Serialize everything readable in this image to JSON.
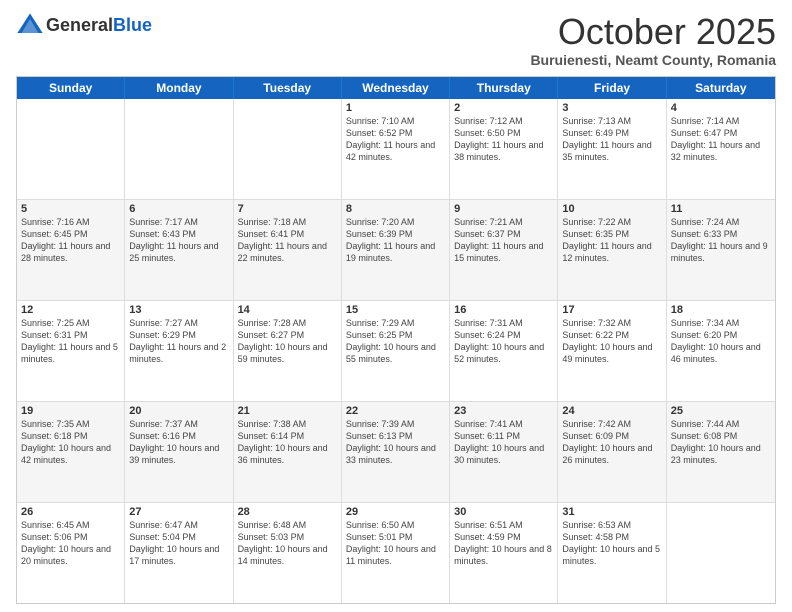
{
  "logo": {
    "general": "General",
    "blue": "Blue"
  },
  "title": "October 2025",
  "location": "Buruienesti, Neamt County, Romania",
  "days": [
    "Sunday",
    "Monday",
    "Tuesday",
    "Wednesday",
    "Thursday",
    "Friday",
    "Saturday"
  ],
  "weeks": [
    [
      {
        "day": "",
        "info": ""
      },
      {
        "day": "",
        "info": ""
      },
      {
        "day": "",
        "info": ""
      },
      {
        "day": "1",
        "info": "Sunrise: 7:10 AM\nSunset: 6:52 PM\nDaylight: 11 hours and 42 minutes."
      },
      {
        "day": "2",
        "info": "Sunrise: 7:12 AM\nSunset: 6:50 PM\nDaylight: 11 hours and 38 minutes."
      },
      {
        "day": "3",
        "info": "Sunrise: 7:13 AM\nSunset: 6:49 PM\nDaylight: 11 hours and 35 minutes."
      },
      {
        "day": "4",
        "info": "Sunrise: 7:14 AM\nSunset: 6:47 PM\nDaylight: 11 hours and 32 minutes."
      }
    ],
    [
      {
        "day": "5",
        "info": "Sunrise: 7:16 AM\nSunset: 6:45 PM\nDaylight: 11 hours and 28 minutes."
      },
      {
        "day": "6",
        "info": "Sunrise: 7:17 AM\nSunset: 6:43 PM\nDaylight: 11 hours and 25 minutes."
      },
      {
        "day": "7",
        "info": "Sunrise: 7:18 AM\nSunset: 6:41 PM\nDaylight: 11 hours and 22 minutes."
      },
      {
        "day": "8",
        "info": "Sunrise: 7:20 AM\nSunset: 6:39 PM\nDaylight: 11 hours and 19 minutes."
      },
      {
        "day": "9",
        "info": "Sunrise: 7:21 AM\nSunset: 6:37 PM\nDaylight: 11 hours and 15 minutes."
      },
      {
        "day": "10",
        "info": "Sunrise: 7:22 AM\nSunset: 6:35 PM\nDaylight: 11 hours and 12 minutes."
      },
      {
        "day": "11",
        "info": "Sunrise: 7:24 AM\nSunset: 6:33 PM\nDaylight: 11 hours and 9 minutes."
      }
    ],
    [
      {
        "day": "12",
        "info": "Sunrise: 7:25 AM\nSunset: 6:31 PM\nDaylight: 11 hours and 5 minutes."
      },
      {
        "day": "13",
        "info": "Sunrise: 7:27 AM\nSunset: 6:29 PM\nDaylight: 11 hours and 2 minutes."
      },
      {
        "day": "14",
        "info": "Sunrise: 7:28 AM\nSunset: 6:27 PM\nDaylight: 10 hours and 59 minutes."
      },
      {
        "day": "15",
        "info": "Sunrise: 7:29 AM\nSunset: 6:25 PM\nDaylight: 10 hours and 55 minutes."
      },
      {
        "day": "16",
        "info": "Sunrise: 7:31 AM\nSunset: 6:24 PM\nDaylight: 10 hours and 52 minutes."
      },
      {
        "day": "17",
        "info": "Sunrise: 7:32 AM\nSunset: 6:22 PM\nDaylight: 10 hours and 49 minutes."
      },
      {
        "day": "18",
        "info": "Sunrise: 7:34 AM\nSunset: 6:20 PM\nDaylight: 10 hours and 46 minutes."
      }
    ],
    [
      {
        "day": "19",
        "info": "Sunrise: 7:35 AM\nSunset: 6:18 PM\nDaylight: 10 hours and 42 minutes."
      },
      {
        "day": "20",
        "info": "Sunrise: 7:37 AM\nSunset: 6:16 PM\nDaylight: 10 hours and 39 minutes."
      },
      {
        "day": "21",
        "info": "Sunrise: 7:38 AM\nSunset: 6:14 PM\nDaylight: 10 hours and 36 minutes."
      },
      {
        "day": "22",
        "info": "Sunrise: 7:39 AM\nSunset: 6:13 PM\nDaylight: 10 hours and 33 minutes."
      },
      {
        "day": "23",
        "info": "Sunrise: 7:41 AM\nSunset: 6:11 PM\nDaylight: 10 hours and 30 minutes."
      },
      {
        "day": "24",
        "info": "Sunrise: 7:42 AM\nSunset: 6:09 PM\nDaylight: 10 hours and 26 minutes."
      },
      {
        "day": "25",
        "info": "Sunrise: 7:44 AM\nSunset: 6:08 PM\nDaylight: 10 hours and 23 minutes."
      }
    ],
    [
      {
        "day": "26",
        "info": "Sunrise: 6:45 AM\nSunset: 5:06 PM\nDaylight: 10 hours and 20 minutes."
      },
      {
        "day": "27",
        "info": "Sunrise: 6:47 AM\nSunset: 5:04 PM\nDaylight: 10 hours and 17 minutes."
      },
      {
        "day": "28",
        "info": "Sunrise: 6:48 AM\nSunset: 5:03 PM\nDaylight: 10 hours and 14 minutes."
      },
      {
        "day": "29",
        "info": "Sunrise: 6:50 AM\nSunset: 5:01 PM\nDaylight: 10 hours and 11 minutes."
      },
      {
        "day": "30",
        "info": "Sunrise: 6:51 AM\nSunset: 4:59 PM\nDaylight: 10 hours and 8 minutes."
      },
      {
        "day": "31",
        "info": "Sunrise: 6:53 AM\nSunset: 4:58 PM\nDaylight: 10 hours and 5 minutes."
      },
      {
        "day": "",
        "info": ""
      }
    ]
  ]
}
